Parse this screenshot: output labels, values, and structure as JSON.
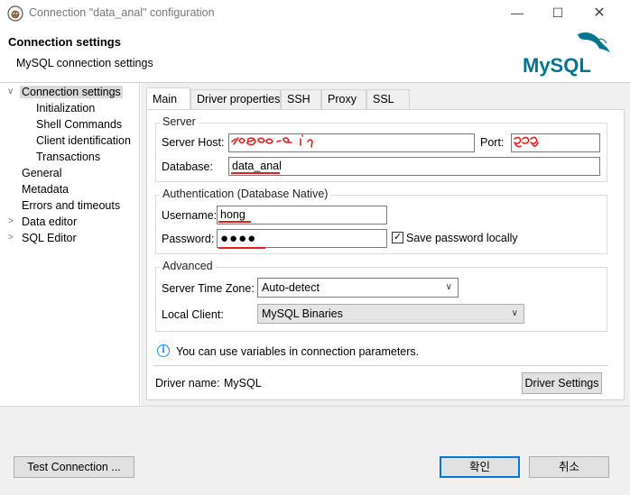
{
  "window": {
    "title": "Connection \"data_anal\" configuration",
    "minimize_glyph": "—",
    "maximize_glyph": "☐",
    "close_glyph": "✕"
  },
  "header": {
    "title": "Connection settings",
    "subtitle": "MySQL connection settings",
    "logo_text": "MySQL"
  },
  "tree": {
    "items": [
      {
        "label": "Connection settings",
        "arrow": "∨",
        "selected": true
      },
      {
        "label": "Initialization"
      },
      {
        "label": "Shell Commands"
      },
      {
        "label": "Client identification"
      },
      {
        "label": "Transactions"
      },
      {
        "label": "General"
      },
      {
        "label": "Metadata"
      },
      {
        "label": "Errors and timeouts"
      },
      {
        "label": "Data editor",
        "arrow": ">"
      },
      {
        "label": "SQL Editor",
        "arrow": ">"
      }
    ]
  },
  "tabs": [
    {
      "label": "Main",
      "active": true
    },
    {
      "label": "Driver properties"
    },
    {
      "label": "SSH"
    },
    {
      "label": "Proxy"
    },
    {
      "label": "SSL"
    }
  ],
  "server": {
    "group_title": "Server",
    "host_label": "Server Host:",
    "host_value": "",
    "port_label": "Port:",
    "port_value": "",
    "database_label": "Database:",
    "database_value": "data_anal"
  },
  "auth": {
    "group_title": "Authentication (Database Native)",
    "username_label": "Username:",
    "username_value": "hong",
    "password_label": "Password:",
    "password_value": "●●●●",
    "save_password_label": "Save password locally",
    "save_password_checked": true,
    "check_glyph": "✓"
  },
  "advanced": {
    "group_title": "Advanced",
    "timezone_label": "Server Time Zone:",
    "timezone_value": "Auto-detect",
    "client_label": "Local Client:",
    "client_value": "MySQL Binaries",
    "chevron_glyph": "∨"
  },
  "info": {
    "icon_glyph": "i",
    "text": "You can use variables in connection parameters."
  },
  "driver": {
    "label": "Driver name:",
    "value": "MySQL",
    "settings_button": "Driver Settings"
  },
  "footer": {
    "test_button": "Test Connection ...",
    "ok_button": "확인",
    "cancel_button": "취소"
  },
  "colors": {
    "accent": "#0078d7",
    "mysql_blue": "#00758f",
    "mysql_orange": "#f29111",
    "annotation_red": "#e02020"
  }
}
